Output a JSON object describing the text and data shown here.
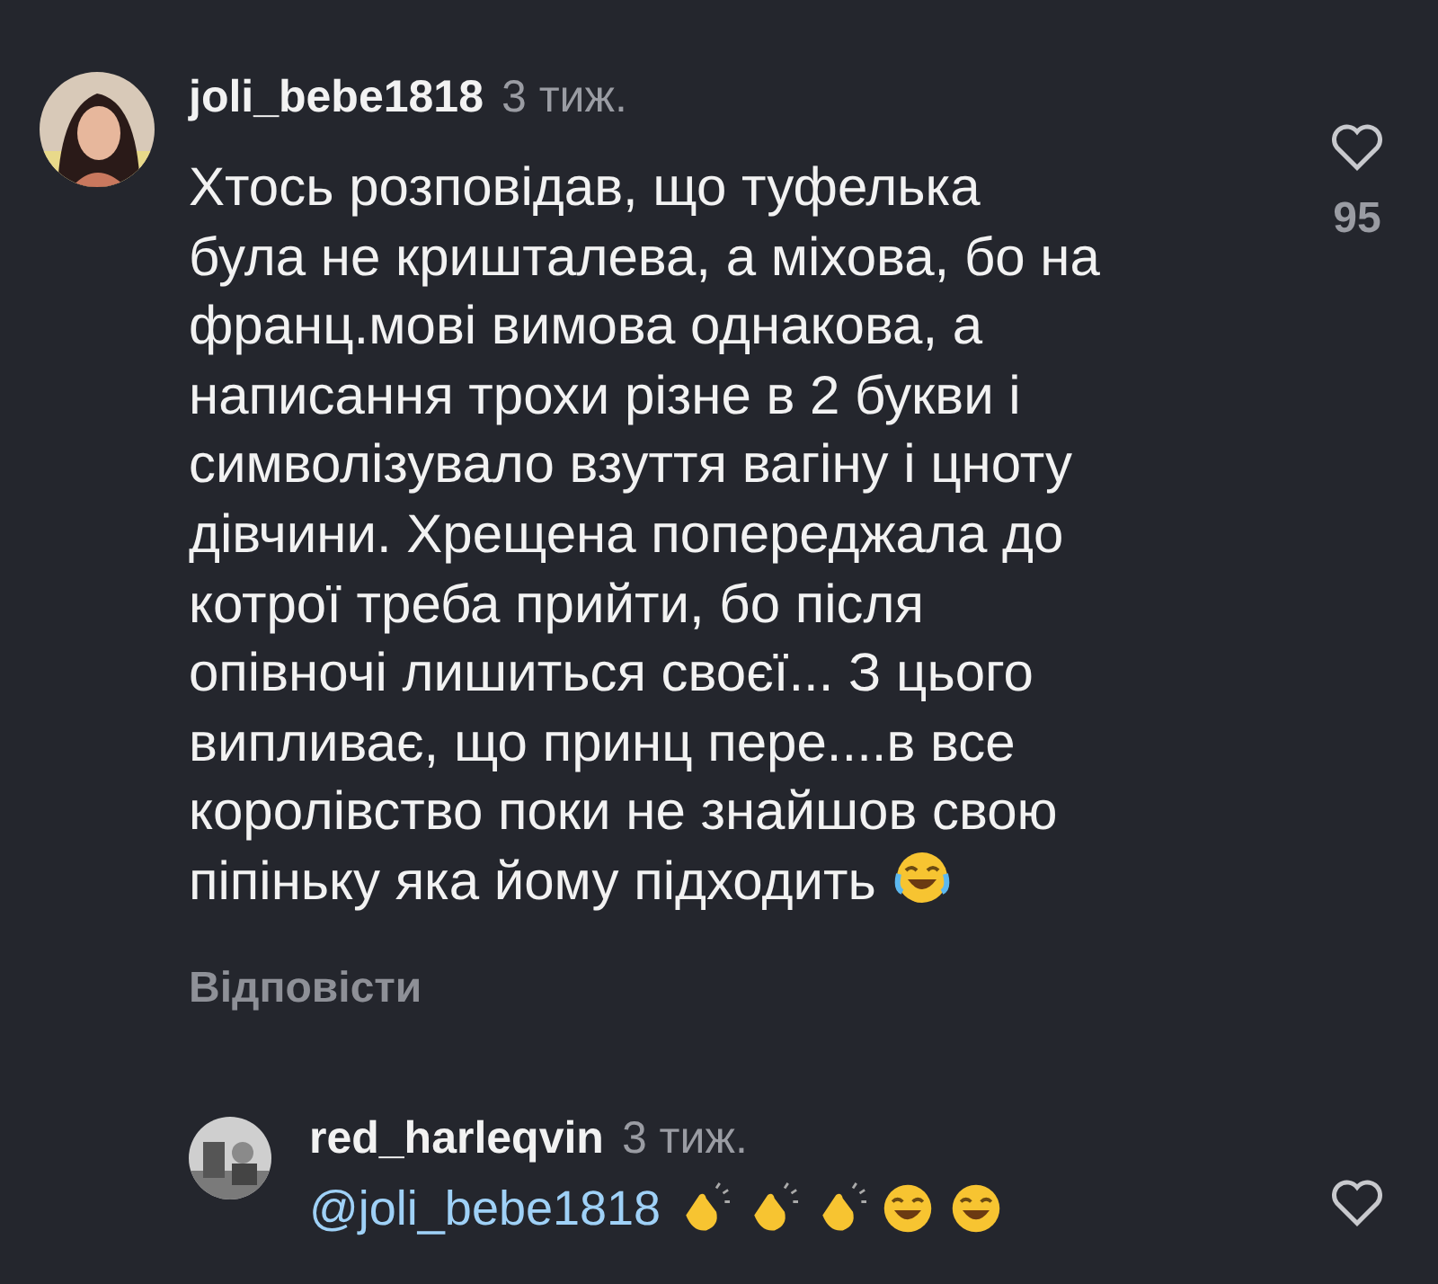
{
  "comments": [
    {
      "username": "joli_bebe1818",
      "time": "3 тиж.",
      "text": "Хтось розповідав, що туфелька\nбула не кришталева, а міхова, бо на\nфранц.мові вимова однакова, а\nнаписання трохи різне в 2 букви і\nсимволізувало взуття вагіну і цноту\nдівчини. Хрещена попереджала до\nкотрої треба прийти, бо після\nопівночі лишиться своєї... З цього\nвипливає, що принц пере....в все\nкоролівство поки не знайшов свою\nпіпіньку яка йому підходить",
      "likes": "95",
      "reply": "Відповісти",
      "liked": false
    },
    {
      "username": "red_harleqvin",
      "time": "3 тиж.",
      "mention": "@joli_bebe1818",
      "liked": false
    }
  ]
}
